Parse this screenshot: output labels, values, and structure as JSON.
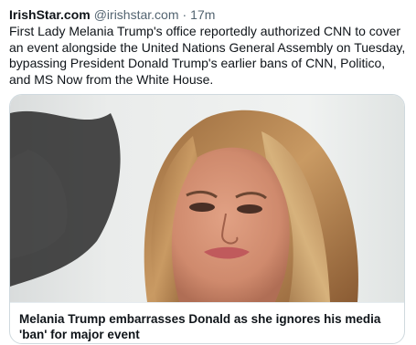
{
  "post": {
    "author": "IrishStar.com",
    "handle": "@irishstar.com",
    "separator": "·",
    "time": "17m",
    "text": "First Lady Melania Trump's office reportedly authorized CNN to cover an event alongside the United Nations General Assembly on Tuesday, bypassing President Donald Trump's earlier bans of CNN, Politico, and MS Now from the White House."
  },
  "card": {
    "image_subject": "photo-of-woman",
    "title": "Melania Trump embarrasses Donald as she ignores his media 'ban' for major event"
  }
}
